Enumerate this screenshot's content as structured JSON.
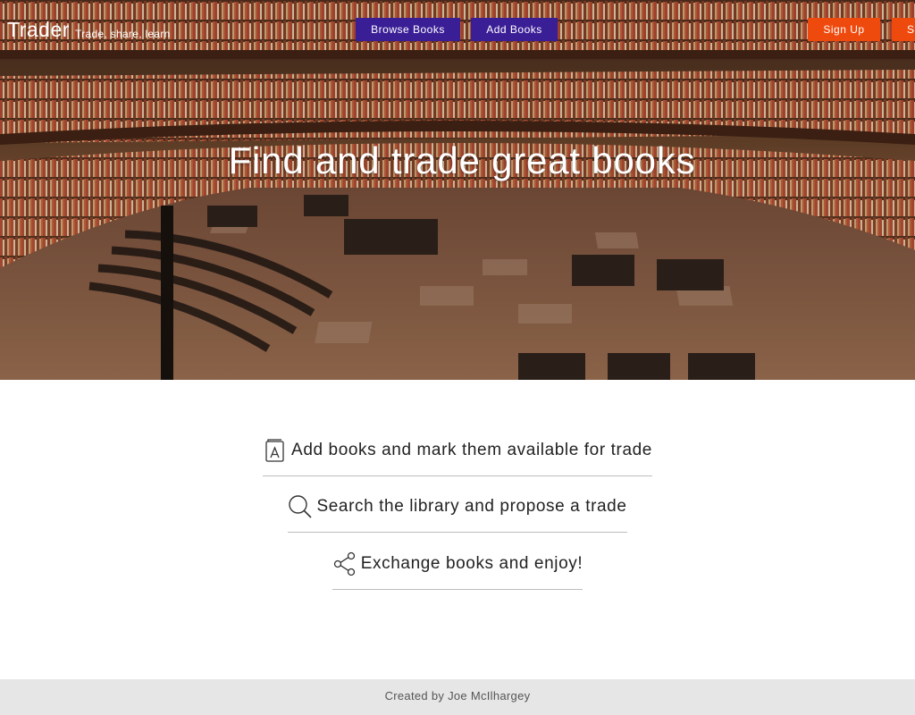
{
  "brand": {
    "name": "Trader",
    "tagline": "Trade, share, learn"
  },
  "nav": {
    "browse_label": "Browse Books",
    "add_label": "Add Books",
    "signup_label": "Sign Up",
    "signin_label": "Sign In"
  },
  "hero": {
    "title": "Find and trade great books"
  },
  "features": [
    {
      "icon": "book-icon",
      "text": "Add books and mark them available for trade"
    },
    {
      "icon": "search-icon",
      "text": "Search the library and propose a trade"
    },
    {
      "icon": "share-icon",
      "text": "Exchange books and enjoy!"
    }
  ],
  "footer": {
    "credit": "Created by Joe McIlhargey"
  },
  "colors": {
    "nav_purple": "#3a1e96",
    "nav_orange": "#ee4a0e",
    "footer_bg": "#e6e6e6",
    "divider": "#bdbdbd"
  }
}
